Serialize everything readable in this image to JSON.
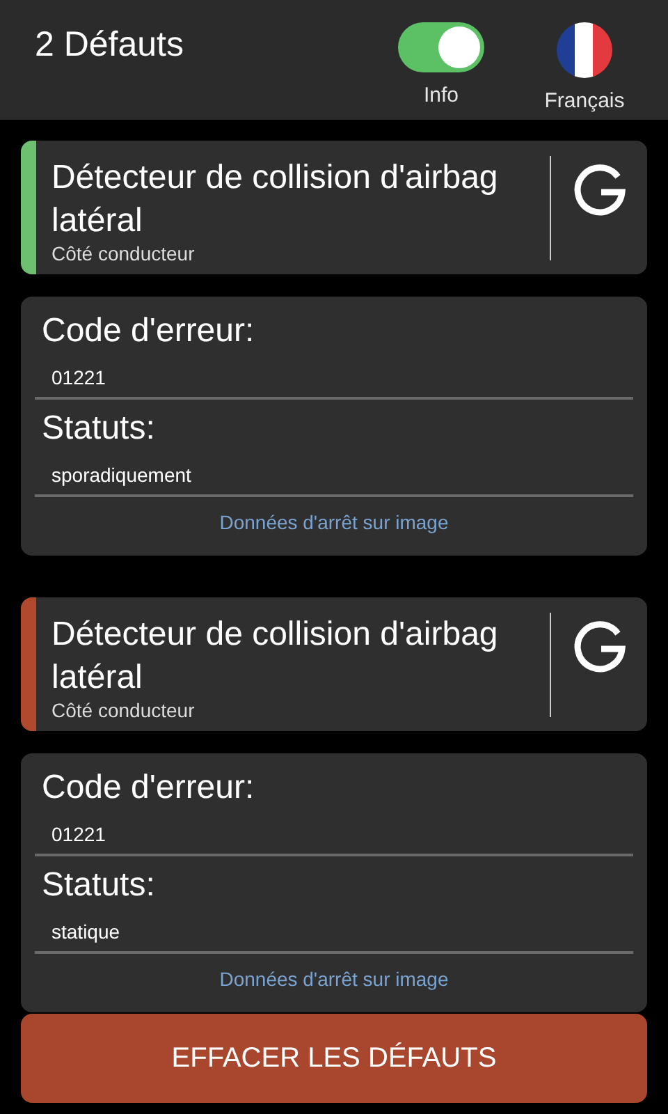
{
  "header": {
    "title": "2 Défauts",
    "info_toggle": {
      "label": "Info",
      "on": true
    },
    "language": {
      "label": "Français"
    }
  },
  "faults": [
    {
      "color": "#6cc070",
      "title": "Détecteur de collision d'airbag latéral",
      "subtitle": "Côté conducteur",
      "code_label": "Code d'erreur:",
      "code": "01221",
      "status_label": "Statuts:",
      "status": "sporadiquement",
      "link": "Données d'arrêt sur image"
    },
    {
      "color": "#b0492e",
      "title": "Détecteur de collision d'airbag latéral",
      "subtitle": "Côté conducteur",
      "code_label": "Code d'erreur:",
      "code": "01221",
      "status_label": "Statuts:",
      "status": "statique",
      "link": "Données d'arrêt sur image"
    }
  ],
  "clear_button": "EFFACER LES DÉFAUTS"
}
